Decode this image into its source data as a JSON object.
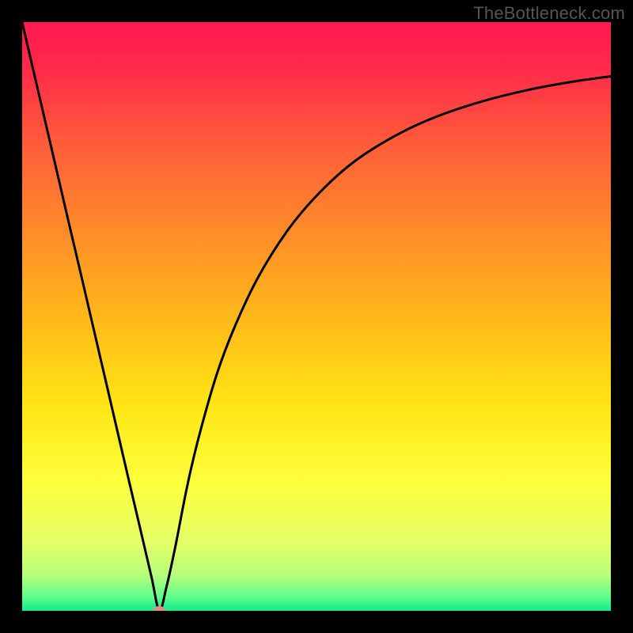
{
  "watermark": "TheBottleneck.com",
  "chart_data": {
    "type": "line",
    "title": "",
    "xlabel": "",
    "ylabel": "",
    "xlim": [
      0,
      100
    ],
    "ylim": [
      0,
      100
    ],
    "background_gradient": {
      "stops": [
        {
          "offset": 0.0,
          "color": "#ff1a4f"
        },
        {
          "offset": 0.08,
          "color": "#ff2a49"
        },
        {
          "offset": 0.2,
          "color": "#ff5a3a"
        },
        {
          "offset": 0.35,
          "color": "#ff8a2a"
        },
        {
          "offset": 0.5,
          "color": "#ffb81a"
        },
        {
          "offset": 0.65,
          "color": "#ffe514"
        },
        {
          "offset": 0.78,
          "color": "#fdff3b"
        },
        {
          "offset": 0.88,
          "color": "#e6ff66"
        },
        {
          "offset": 0.94,
          "color": "#b6ff7a"
        },
        {
          "offset": 0.975,
          "color": "#62ff8c"
        },
        {
          "offset": 1.0,
          "color": "#15e98b"
        }
      ]
    },
    "series": [
      {
        "name": "bottleneck-curve",
        "color": "#000000",
        "x": [
          0,
          2,
          4,
          6,
          8,
          10,
          12,
          14,
          16,
          18,
          20,
          22,
          23.3,
          24.5,
          26,
          28,
          30,
          33,
          36,
          40,
          45,
          50,
          56,
          63,
          70,
          78,
          86,
          93,
          100
        ],
        "y": [
          100,
          91.4,
          82.8,
          74.2,
          65.6,
          57.1,
          48.5,
          39.9,
          31.3,
          22.7,
          14.2,
          5.6,
          0,
          4,
          10.8,
          21,
          29.5,
          40,
          48,
          56.5,
          64.5,
          70.5,
          76,
          80.5,
          83.8,
          86.5,
          88.5,
          89.8,
          90.8
        ]
      }
    ],
    "marker": {
      "name": "optimal-point",
      "x": 23.3,
      "y": 0,
      "rx": 1.1,
      "ry": 0.8,
      "color": "#d99088"
    }
  }
}
